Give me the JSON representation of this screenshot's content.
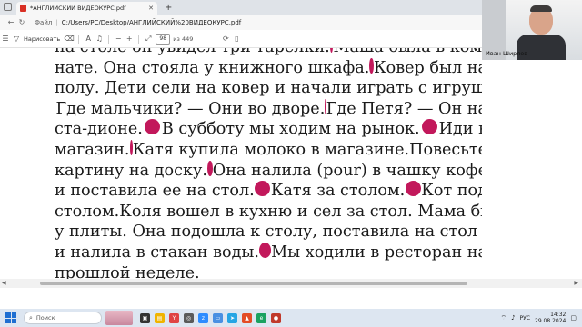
{
  "browser": {
    "tab_title": "*АНГЛИЙСКИЙ ВИДЕОКУРС.pdf",
    "tab_close": "✕",
    "new_tab": "+",
    "address_label": "Файл",
    "address_url": "C:/Users/PC/Desktop/АНГЛИЙСКИЙ%20ВИДЕОКУРС.pdf"
  },
  "pdf_toolbar": {
    "draw_label": "Нарисовать",
    "page_current": "98",
    "page_total": "из 449",
    "zoom_minus": "−",
    "zoom_plus": "+"
  },
  "document": {
    "lines": [
      {
        "parts": [
          "на столе он увидел три тарелки.",
          "DOT",
          "Маша была в ком-"
        ],
        "justify": true
      },
      {
        "parts": [
          "нате. Она стояла у книжного шкафа.",
          "DOT",
          "Ковер был на"
        ],
        "justify": true
      },
      {
        "parts": [
          "полу. Дети сели на ковер и начали играть с игрушками."
        ],
        "justify": true
      },
      {
        "parts": [
          "DOT",
          "Где мальчики? — Они во дворе.",
          "DOT",
          "Где Петя? — Он на"
        ],
        "justify": true
      },
      {
        "parts": [
          "ста-дионе.",
          "DOT",
          "В субботу мы ходим на рынок.",
          "DOT",
          "Иди в"
        ],
        "justify": true
      },
      {
        "parts": [
          "магазин.",
          "DOT",
          "Катя купила молоко в магазине.",
          "Повесьте"
        ],
        "justify": true
      },
      {
        "parts": [
          "картину на доску.",
          "DOT",
          "Она налила (pour) в чашку кофе"
        ],
        "justify": true
      },
      {
        "parts": [
          "и поставила ее на стол.",
          "DOT",
          "Катя за столом.",
          "DOT",
          "Кот под"
        ],
        "justify": true
      },
      {
        "parts": [
          "столом.",
          "DOT",
          "Коля вошел в кухню и сел за стол. Мама была"
        ],
        "justify": true
      },
      {
        "parts": [
          "у плиты. Она подошла к столу, поставила на стол стакан"
        ],
        "justify": true
      },
      {
        "parts": [
          "и налила в стакан воды.",
          "DOT",
          "Мы ходили в ресторан на"
        ],
        "justify": true
      },
      {
        "parts": [
          "прошлой неделе."
        ],
        "justify": false
      }
    ]
  },
  "webcam": {
    "name": "Иван Ширяев"
  },
  "taskbar": {
    "search_placeholder": "Поиск",
    "lang": "РУС",
    "time": "14:32",
    "date": "29.08.2024"
  },
  "colors": {
    "bullet": "#c2185b",
    "accent": "#1f6fd1"
  },
  "icons": [
    "pdf-icon",
    "close-icon",
    "back-icon",
    "forward-icon",
    "refresh-icon",
    "search-icon",
    "highlight-icon",
    "eraser-icon",
    "text-icon",
    "zoom-in-icon",
    "zoom-out-icon",
    "windows-start-icon"
  ]
}
